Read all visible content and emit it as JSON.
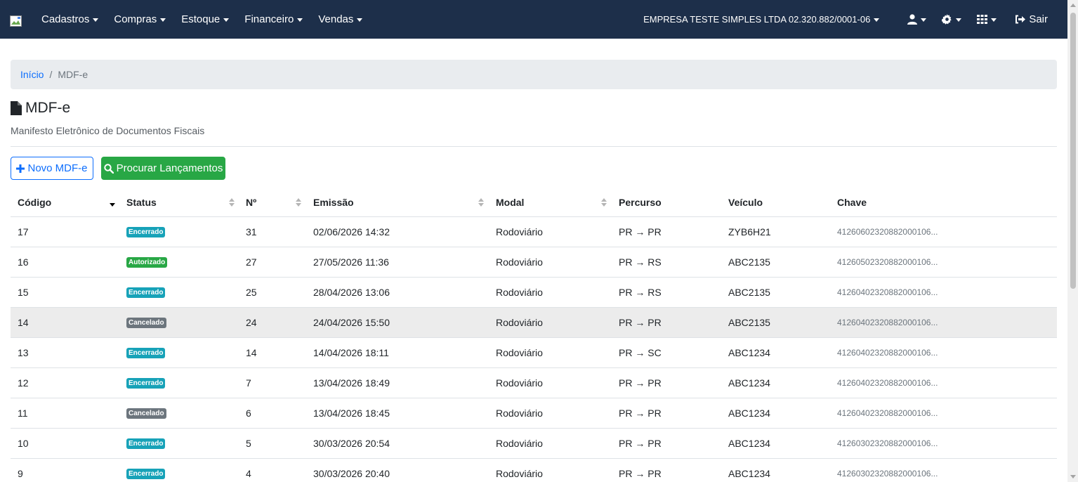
{
  "navbar": {
    "menu": [
      {
        "label": "Cadastros"
      },
      {
        "label": "Compras"
      },
      {
        "label": "Estoque"
      },
      {
        "label": "Financeiro"
      },
      {
        "label": "Vendas"
      }
    ],
    "company": "EMPRESA TESTE SIMPLES LTDA 02.320.882/0001-06",
    "logout_label": "Sair",
    "icons": [
      "user-icon",
      "gear-icon",
      "grid-icon",
      "sign-out-icon"
    ]
  },
  "breadcrumb": {
    "home": "Início",
    "separator": "/",
    "current": "MDF-e"
  },
  "page": {
    "title": "MDF-e",
    "subtitle": "Manifesto Eletrônico de Documentos Fiscais"
  },
  "actions": {
    "new_label": "Novo MDF-e",
    "search_label": "Procurar Lançamentos"
  },
  "table": {
    "headers": {
      "codigo": "Código",
      "status": "Status",
      "numero": "Nº",
      "emissao": "Emissão",
      "modal": "Modal",
      "percurso": "Percurso",
      "veiculo": "Veículo",
      "chave": "Chave"
    },
    "rows": [
      {
        "codigo": "17",
        "status": "Encerrado",
        "status_type": "encerrado",
        "numero": "31",
        "emissao": "02/06/2026 14:32",
        "modal": "Rodoviário",
        "percurso": "PR → PR",
        "veiculo": "ZYB6H21",
        "chave": "4126060232088200010​6..."
      },
      {
        "codigo": "16",
        "status": "Autorizado",
        "status_type": "autorizado",
        "numero": "27",
        "emissao": "27/05/2026 11:36",
        "modal": "Rodoviário",
        "percurso": "PR → RS",
        "veiculo": "ABC2135",
        "chave": "4126050232088200010​6..."
      },
      {
        "codigo": "15",
        "status": "Encerrado",
        "status_type": "encerrado",
        "numero": "25",
        "emissao": "28/04/2026 13:06",
        "modal": "Rodoviário",
        "percurso": "PR → RS",
        "veiculo": "ABC2135",
        "chave": "4126040232088200010​6..."
      },
      {
        "codigo": "14",
        "status": "Cancelado",
        "status_type": "cancelado",
        "numero": "24",
        "emissao": "24/04/2026 15:50",
        "modal": "Rodoviário",
        "percurso": "PR → PR",
        "veiculo": "ABC2135",
        "chave": "4126040232088200010​6..."
      },
      {
        "codigo": "13",
        "status": "Encerrado",
        "status_type": "encerrado",
        "numero": "14",
        "emissao": "14/04/2026 18:11",
        "modal": "Rodoviário",
        "percurso": "PR → SC",
        "veiculo": "ABC1234",
        "chave": "4126040232088200010​6..."
      },
      {
        "codigo": "12",
        "status": "Encerrado",
        "status_type": "encerrado",
        "numero": "7",
        "emissao": "13/04/2026 18:49",
        "modal": "Rodoviário",
        "percurso": "PR → PR",
        "veiculo": "ABC1234",
        "chave": "4126040232088200010​6..."
      },
      {
        "codigo": "11",
        "status": "Cancelado",
        "status_type": "cancelado",
        "numero": "6",
        "emissao": "13/04/2026 18:45",
        "modal": "Rodoviário",
        "percurso": "PR → PR",
        "veiculo": "ABC1234",
        "chave": "4126040232088200010​6..."
      },
      {
        "codigo": "10",
        "status": "Encerrado",
        "status_type": "encerrado",
        "numero": "5",
        "emissao": "30/03/2026 20:54",
        "modal": "Rodoviário",
        "percurso": "PR → PR",
        "veiculo": "ABC1234",
        "chave": "4126030232088200010​6..."
      },
      {
        "codigo": "9",
        "status": "Encerrado",
        "status_type": "encerrado",
        "numero": "4",
        "emissao": "30/03/2026 20:40",
        "modal": "Rodoviário",
        "percurso": "PR → PR",
        "veiculo": "ABC1234",
        "chave": "4126030232088200010​6..."
      }
    ],
    "highlighted_row": 3
  },
  "colors": {
    "navbar_bg": "#1d2f4a",
    "primary": "#0d6efd",
    "success": "#28a745",
    "info": "#17a2b8",
    "secondary": "#6c757d"
  }
}
